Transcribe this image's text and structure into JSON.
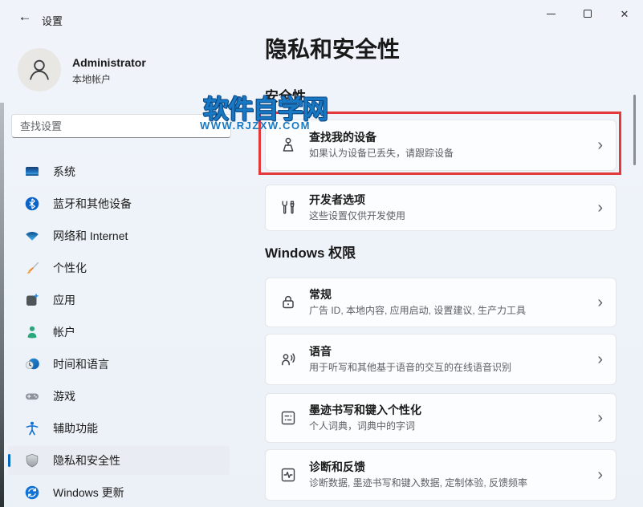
{
  "window": {
    "app_title": "设置"
  },
  "icons": {
    "back": "←",
    "chevron": "›",
    "close": "✕"
  },
  "sidebar": {
    "user": {
      "name": "Administrator",
      "account_type": "本地帐户"
    },
    "search_placeholder": "查找设置",
    "items": [
      {
        "label": "系统"
      },
      {
        "label": "蓝牙和其他设备"
      },
      {
        "label": "网络和 Internet"
      },
      {
        "label": "个性化"
      },
      {
        "label": "应用"
      },
      {
        "label": "帐户"
      },
      {
        "label": "时间和语言"
      },
      {
        "label": "游戏"
      },
      {
        "label": "辅助功能"
      },
      {
        "label": "隐私和安全性",
        "selected": true
      },
      {
        "label": "Windows 更新"
      }
    ]
  },
  "main": {
    "page_title": "隐私和安全性",
    "sections": [
      {
        "header": "安全性",
        "cards": [
          {
            "title": "查找我的设备",
            "subtitle": "如果认为设备已丢失，请跟踪设备"
          },
          {
            "title": "开发者选项",
            "subtitle": "这些设置仅供开发使用"
          }
        ]
      },
      {
        "header": "Windows 权限",
        "cards": [
          {
            "title": "常规",
            "subtitle": "广告 ID, 本地内容, 应用启动, 设置建议, 生产力工具"
          },
          {
            "title": "语音",
            "subtitle": "用于听写和其他基于语音的交互的在线语音识别"
          },
          {
            "title": "墨迹书写和键入个性化",
            "subtitle": "个人词典，词典中的字词"
          },
          {
            "title": "诊断和反馈",
            "subtitle": "诊断数据, 墨迹书写和键入数据, 定制体验, 反馈频率"
          }
        ]
      }
    ]
  },
  "watermark": {
    "line1": "软件自学网",
    "line2": "WWW.RJZXW.COM",
    "color": "#1779c4"
  },
  "annotation": {
    "highlight_color": "#e23a3a"
  },
  "colors": {
    "accent": "#0067c0"
  }
}
